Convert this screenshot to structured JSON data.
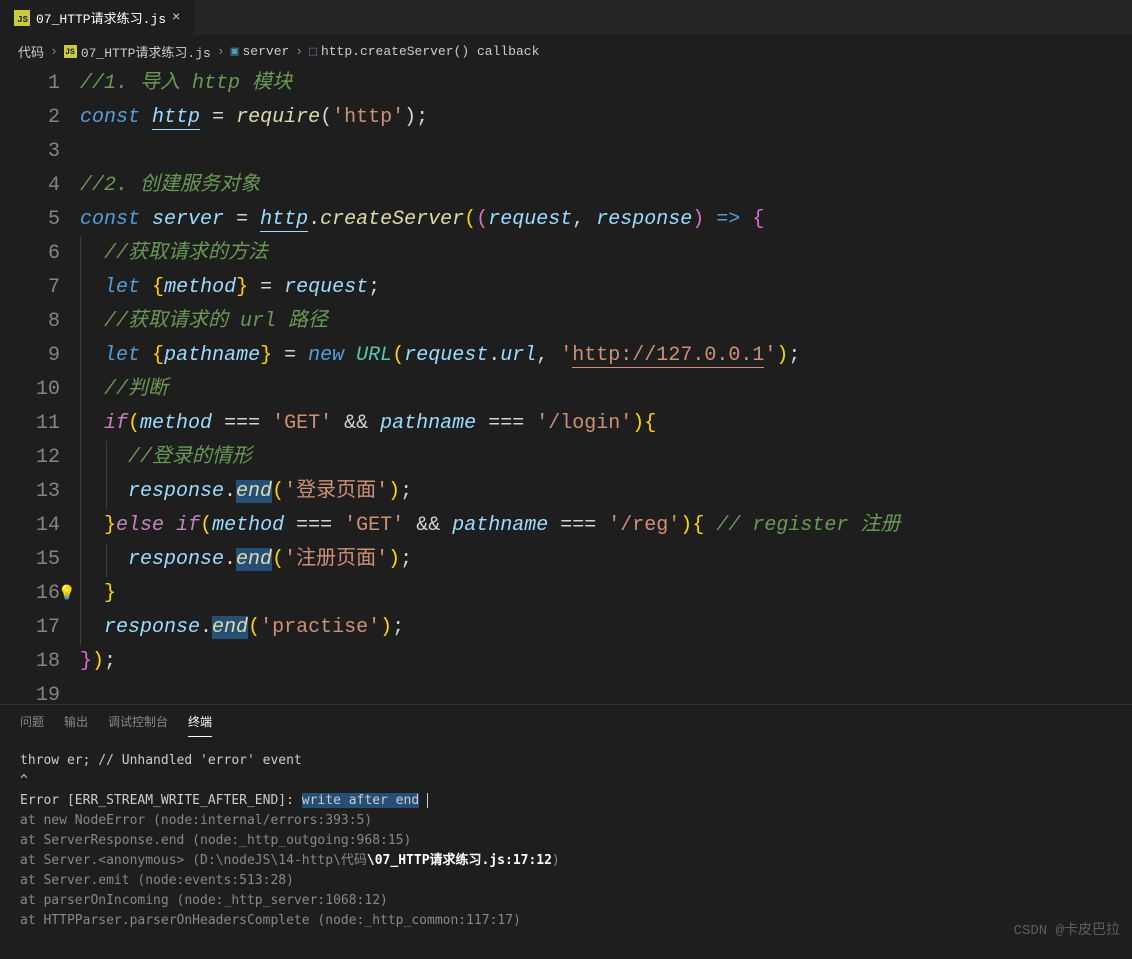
{
  "tab": {
    "filename": "07_HTTP请求练习.js",
    "lang_badge": "JS"
  },
  "breadcrumb": {
    "items": [
      "代码",
      "07_HTTP请求练习.js",
      "server",
      "http.createServer() callback"
    ]
  },
  "code": {
    "lines": [
      {
        "n": 1,
        "tokens": [
          {
            "c": "c-comment",
            "t": "//1. 导入 http 模块"
          }
        ]
      },
      {
        "n": 2,
        "tokens": [
          {
            "c": "c-keyword-blue",
            "t": "const"
          },
          {
            "c": "c-white",
            "t": " "
          },
          {
            "c": "c-varlink",
            "t": "http"
          },
          {
            "c": "c-white",
            "t": " "
          },
          {
            "c": "c-op",
            "t": "="
          },
          {
            "c": "c-white",
            "t": " "
          },
          {
            "c": "c-func",
            "t": "require"
          },
          {
            "c": "c-paren",
            "t": "("
          },
          {
            "c": "c-string",
            "t": "'http'"
          },
          {
            "c": "c-paren",
            "t": ")"
          },
          {
            "c": "c-op",
            "t": ";"
          }
        ]
      },
      {
        "n": 3,
        "tokens": []
      },
      {
        "n": 4,
        "tokens": [
          {
            "c": "c-comment",
            "t": "//2. 创建服务对象"
          }
        ]
      },
      {
        "n": 5,
        "tokens": [
          {
            "c": "c-keyword-blue",
            "t": "const"
          },
          {
            "c": "c-white",
            "t": " "
          },
          {
            "c": "c-var",
            "t": "server"
          },
          {
            "c": "c-white",
            "t": " "
          },
          {
            "c": "c-op",
            "t": "="
          },
          {
            "c": "c-white",
            "t": " "
          },
          {
            "c": "c-varlink",
            "t": "http"
          },
          {
            "c": "c-op",
            "t": "."
          },
          {
            "c": "c-func",
            "t": "createServer"
          },
          {
            "c": "c-brace-y",
            "t": "("
          },
          {
            "c": "c-brace-p",
            "t": "("
          },
          {
            "c": "c-var",
            "t": "request"
          },
          {
            "c": "c-op",
            "t": ","
          },
          {
            "c": "c-white",
            "t": " "
          },
          {
            "c": "c-var",
            "t": "response"
          },
          {
            "c": "c-brace-p",
            "t": ")"
          },
          {
            "c": "c-white",
            "t": " "
          },
          {
            "c": "c-keyword-blue",
            "t": "=>"
          },
          {
            "c": "c-white",
            "t": " "
          },
          {
            "c": "c-brace-p",
            "t": "{"
          }
        ]
      },
      {
        "n": 6,
        "indent": 1,
        "tokens": [
          {
            "c": "c-comment",
            "t": "//获取请求的方法"
          }
        ]
      },
      {
        "n": 7,
        "indent": 1,
        "tokens": [
          {
            "c": "c-keyword-blue",
            "t": "let"
          },
          {
            "c": "c-white",
            "t": " "
          },
          {
            "c": "c-brace-y",
            "t": "{"
          },
          {
            "c": "c-var",
            "t": "method"
          },
          {
            "c": "c-brace-y",
            "t": "}"
          },
          {
            "c": "c-white",
            "t": " "
          },
          {
            "c": "c-op",
            "t": "="
          },
          {
            "c": "c-white",
            "t": " "
          },
          {
            "c": "c-var",
            "t": "request"
          },
          {
            "c": "c-op",
            "t": ";"
          }
        ]
      },
      {
        "n": 8,
        "indent": 1,
        "tokens": [
          {
            "c": "c-comment",
            "t": "//获取请求的 url 路径"
          }
        ]
      },
      {
        "n": 9,
        "indent": 1,
        "tokens": [
          {
            "c": "c-keyword-blue",
            "t": "let"
          },
          {
            "c": "c-white",
            "t": " "
          },
          {
            "c": "c-brace-y",
            "t": "{"
          },
          {
            "c": "c-var",
            "t": "pathname"
          },
          {
            "c": "c-brace-y",
            "t": "}"
          },
          {
            "c": "c-white",
            "t": " "
          },
          {
            "c": "c-op",
            "t": "="
          },
          {
            "c": "c-white",
            "t": " "
          },
          {
            "c": "c-keyword-blue",
            "t": "new"
          },
          {
            "c": "c-white",
            "t": " "
          },
          {
            "c": "c-class",
            "t": "URL"
          },
          {
            "c": "c-brace-y",
            "t": "("
          },
          {
            "c": "c-var",
            "t": "request"
          },
          {
            "c": "c-op",
            "t": "."
          },
          {
            "c": "c-var",
            "t": "url"
          },
          {
            "c": "c-op",
            "t": ","
          },
          {
            "c": "c-white",
            "t": " "
          },
          {
            "c": "c-string",
            "t": "'"
          },
          {
            "c": "c-stringlink",
            "t": "http://127.0.0.1"
          },
          {
            "c": "c-string",
            "t": "'"
          },
          {
            "c": "c-brace-y",
            "t": ")"
          },
          {
            "c": "c-op",
            "t": ";"
          }
        ]
      },
      {
        "n": 10,
        "indent": 1,
        "tokens": [
          {
            "c": "c-comment",
            "t": "//判断"
          }
        ]
      },
      {
        "n": 11,
        "indent": 1,
        "tokens": [
          {
            "c": "c-keyword-pink",
            "t": "if"
          },
          {
            "c": "c-brace-y",
            "t": "("
          },
          {
            "c": "c-var",
            "t": "method"
          },
          {
            "c": "c-white",
            "t": " "
          },
          {
            "c": "c-op",
            "t": "==="
          },
          {
            "c": "c-white",
            "t": " "
          },
          {
            "c": "c-string",
            "t": "'GET'"
          },
          {
            "c": "c-white",
            "t": " "
          },
          {
            "c": "c-op",
            "t": "&&"
          },
          {
            "c": "c-white",
            "t": " "
          },
          {
            "c": "c-var",
            "t": "pathname"
          },
          {
            "c": "c-white",
            "t": " "
          },
          {
            "c": "c-op",
            "t": "==="
          },
          {
            "c": "c-white",
            "t": " "
          },
          {
            "c": "c-string",
            "t": "'/login'"
          },
          {
            "c": "c-brace-y",
            "t": ")"
          },
          {
            "c": "c-brace-y",
            "t": "{"
          }
        ]
      },
      {
        "n": 12,
        "indent": 2,
        "tokens": [
          {
            "c": "c-comment",
            "t": "//登录的情形"
          }
        ]
      },
      {
        "n": 13,
        "indent": 2,
        "tokens": [
          {
            "c": "c-var",
            "t": "response"
          },
          {
            "c": "c-op",
            "t": "."
          },
          {
            "c": "c-funcsel",
            "t": "end"
          },
          {
            "c": "c-brace-y",
            "t": "("
          },
          {
            "c": "c-string",
            "t": "'登录页面'"
          },
          {
            "c": "c-brace-y",
            "t": ")"
          },
          {
            "c": "c-op",
            "t": ";"
          }
        ]
      },
      {
        "n": 14,
        "indent": 1,
        "tokens": [
          {
            "c": "c-brace-y",
            "t": "}"
          },
          {
            "c": "c-keyword-pink",
            "t": "else"
          },
          {
            "c": "c-white",
            "t": " "
          },
          {
            "c": "c-keyword-pink",
            "t": "if"
          },
          {
            "c": "c-brace-y",
            "t": "("
          },
          {
            "c": "c-var",
            "t": "method"
          },
          {
            "c": "c-white",
            "t": " "
          },
          {
            "c": "c-op",
            "t": "==="
          },
          {
            "c": "c-white",
            "t": " "
          },
          {
            "c": "c-string",
            "t": "'GET'"
          },
          {
            "c": "c-white",
            "t": " "
          },
          {
            "c": "c-op",
            "t": "&&"
          },
          {
            "c": "c-white",
            "t": " "
          },
          {
            "c": "c-var",
            "t": "pathname"
          },
          {
            "c": "c-white",
            "t": " "
          },
          {
            "c": "c-op",
            "t": "==="
          },
          {
            "c": "c-white",
            "t": " "
          },
          {
            "c": "c-string",
            "t": "'/reg'"
          },
          {
            "c": "c-brace-y",
            "t": ")"
          },
          {
            "c": "c-brace-y",
            "t": "{"
          },
          {
            "c": "c-white",
            "t": " "
          },
          {
            "c": "c-comment",
            "t": "// register 注册"
          }
        ]
      },
      {
        "n": 15,
        "indent": 2,
        "tokens": [
          {
            "c": "c-var",
            "t": "response"
          },
          {
            "c": "c-op",
            "t": "."
          },
          {
            "c": "c-funcsel",
            "t": "end"
          },
          {
            "c": "c-brace-y",
            "t": "("
          },
          {
            "c": "c-string",
            "t": "'注册页面'"
          },
          {
            "c": "c-brace-y",
            "t": ")"
          },
          {
            "c": "c-op",
            "t": ";"
          }
        ]
      },
      {
        "n": 16,
        "indent": 1,
        "bulb": true,
        "tokens": [
          {
            "c": "c-brace-y",
            "t": "}"
          }
        ]
      },
      {
        "n": 17,
        "indent": 1,
        "tokens": [
          {
            "c": "c-var",
            "t": "response"
          },
          {
            "c": "c-op",
            "t": "."
          },
          {
            "c": "c-funcsel",
            "t": "end"
          },
          {
            "c": "c-brace-y",
            "t": "("
          },
          {
            "c": "c-string",
            "t": "'practise'"
          },
          {
            "c": "c-brace-y",
            "t": ")"
          },
          {
            "c": "c-op",
            "t": ";"
          }
        ]
      },
      {
        "n": 18,
        "tokens": [
          {
            "c": "c-brace-p",
            "t": "}"
          },
          {
            "c": "c-brace-y",
            "t": ")"
          },
          {
            "c": "c-op",
            "t": ";"
          }
        ]
      },
      {
        "n": 19,
        "tokens": []
      }
    ]
  },
  "terminal": {
    "tabs": [
      "问题",
      "输出",
      "调试控制台",
      "终端"
    ],
    "active_tab": 3,
    "lines": [
      {
        "segs": [
          {
            "t": "    throw er; // Unhandled 'error' event",
            "c": ""
          }
        ]
      },
      {
        "segs": [
          {
            "t": "    ^",
            "c": ""
          }
        ]
      },
      {
        "segs": [
          {
            "t": " ",
            "c": ""
          }
        ]
      },
      {
        "segs": [
          {
            "t": "Error [ERR_STREAM_WRITE_AFTER_END]: ",
            "c": ""
          },
          {
            "t": "write after end",
            "c": "term-highlight"
          },
          {
            "t": "     ",
            "c": ""
          },
          {
            "t": "",
            "c": "",
            "cursor": true
          }
        ]
      },
      {
        "segs": [
          {
            "t": "    at new NodeError (node:internal/errors:393:5)",
            "c": "term-path"
          }
        ]
      },
      {
        "segs": [
          {
            "t": "    at ServerResponse.end (node:_http_outgoing:968:15)",
            "c": "term-path"
          }
        ]
      },
      {
        "segs": [
          {
            "t": "    at Server.<anonymous> ",
            "c": "term-path"
          },
          {
            "t": "(",
            "c": "term-path"
          },
          {
            "t": "D:\\nodeJS\\14-http\\代码",
            "c": "term-path"
          },
          {
            "t": "\\07_HTTP请求练习.js:17:12",
            "c": "term-bold"
          },
          {
            "t": ")",
            "c": "term-path"
          }
        ]
      },
      {
        "segs": [
          {
            "t": "    at Server.emit (node:events:513:28)",
            "c": "term-path"
          }
        ]
      },
      {
        "segs": [
          {
            "t": "    at parserOnIncoming (node:_http_server:1068:12)",
            "c": "term-path"
          }
        ]
      },
      {
        "segs": [
          {
            "t": "    at HTTPParser.parserOnHeadersComplete (node:_http_common:117:17)",
            "c": "term-path"
          }
        ]
      }
    ]
  },
  "watermark": "CSDN @卡皮巴拉"
}
